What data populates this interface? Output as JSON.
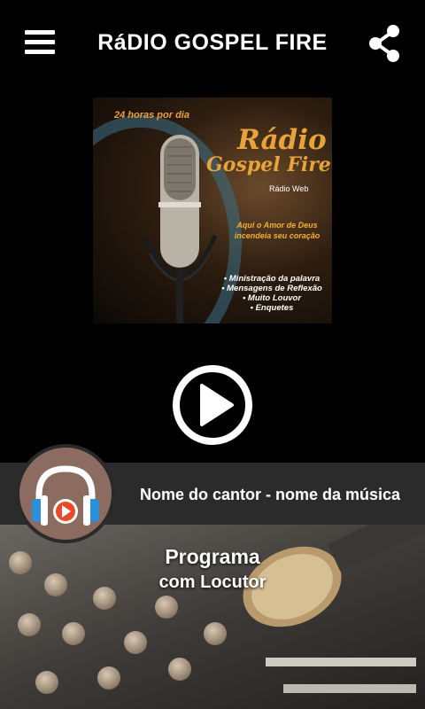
{
  "header": {
    "title": "RáDIO GOSPEL FIRE"
  },
  "cover": {
    "top_line": "24 horas por dia",
    "brand_line1": "Rádio",
    "brand_line2": "Gospel Fire",
    "subtitle": "Rádio Web",
    "tagline": "Aqui o Amor de Deus incendeia seu coração",
    "bullets": [
      "• Ministração da palavra",
      "• Mensagens de Reflexão",
      "• Muito Louvor",
      "• Enquetes"
    ]
  },
  "player": {
    "now_playing": "Nome do cantor - nome da música",
    "program": "Programa",
    "host": "com Locutor"
  },
  "colors": {
    "background": "#000000",
    "bar": "#2b2b2b",
    "accent_orange": "#e8a33a",
    "headphones_blue": "#2b8fd9"
  },
  "icons": [
    "menu-icon",
    "share-icon",
    "play-icon",
    "headphones-icon"
  ]
}
